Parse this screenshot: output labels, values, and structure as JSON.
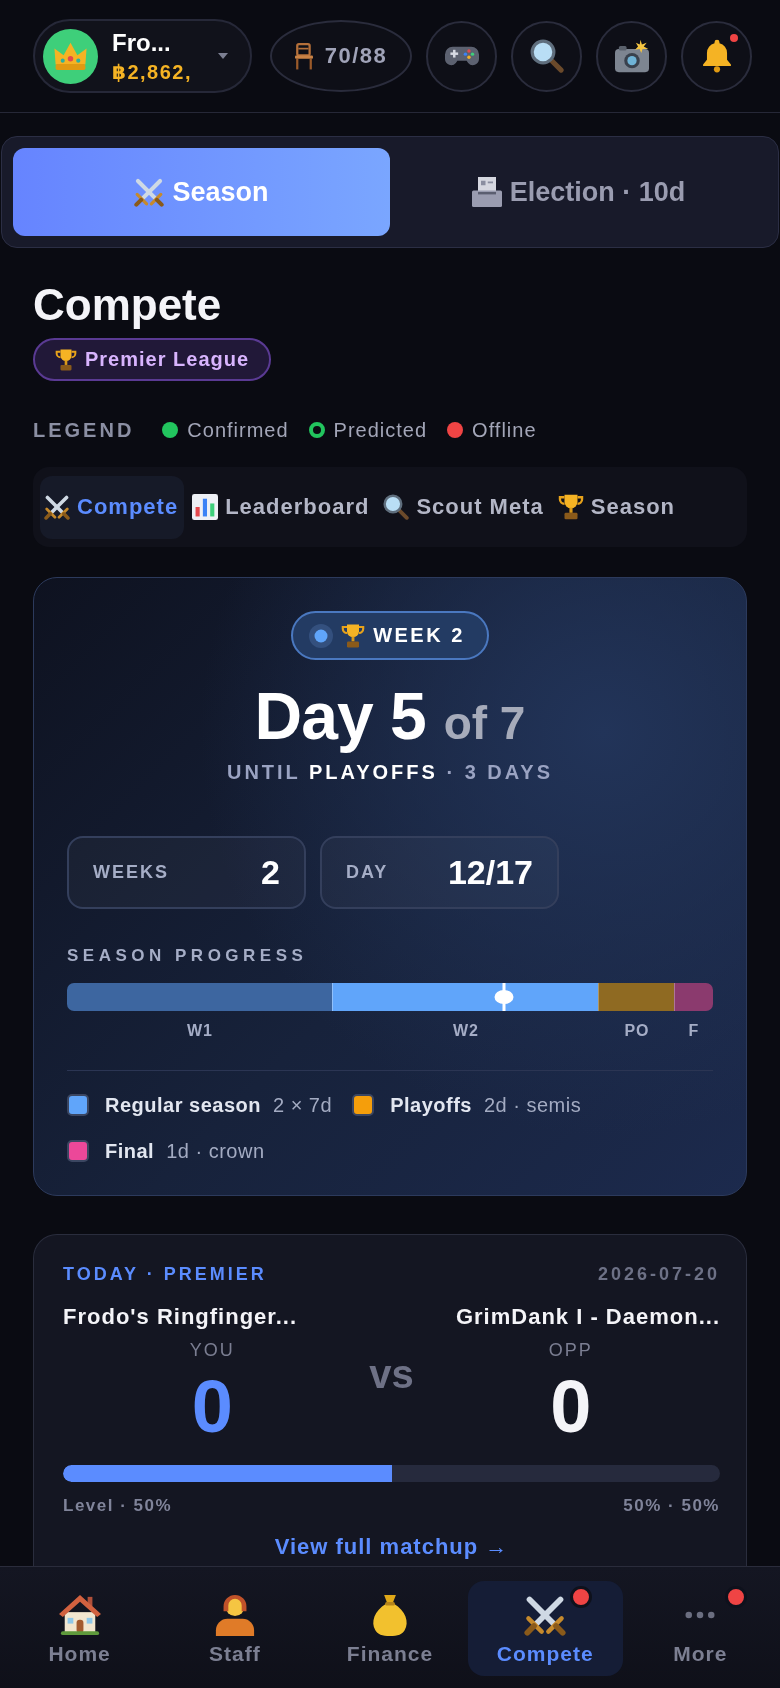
{
  "top_bar": {
    "profile": {
      "name": "Fro...",
      "balance": "฿2,862,"
    },
    "seats": "70/88",
    "actions": [
      {
        "badge": false
      },
      {
        "badge": false
      },
      {
        "badge": false
      },
      {
        "badge": true
      }
    ]
  },
  "mode_tabs": [
    {
      "label": "Season",
      "selected": true
    },
    {
      "label": "Election · 10d",
      "selected": false
    }
  ],
  "page": {
    "title": "Compete",
    "league": "Premier League"
  },
  "legend": {
    "title": "LEGEND",
    "items": [
      {
        "label": "Confirmed",
        "kind": "filled",
        "color": "#22c55e"
      },
      {
        "label": "Predicted",
        "kind": "ring",
        "color": "#22c55e"
      },
      {
        "label": "Offline",
        "kind": "filled",
        "color": "#ef4444"
      }
    ]
  },
  "section_tabs": [
    {
      "label": "Compete",
      "selected": true
    },
    {
      "label": "Leaderboard",
      "selected": false
    },
    {
      "label": "Scout Meta",
      "selected": false
    },
    {
      "label": "Season",
      "selected": false
    }
  ],
  "season_card": {
    "week": "WEEK 2",
    "day": "Day 5",
    "day_total": "of 7",
    "countdown": "UNTIL **PLAYOFFS** · 3 DAYS",
    "stats": [
      {
        "label": "WEEKS",
        "value": "2"
      },
      {
        "label": "DAY",
        "value": "12/17"
      }
    ],
    "progress": {
      "title": "SEASON PROGRESS",
      "segments": [
        {
          "label": "W1",
          "kind": "week",
          "color": "#3d66a0"
        },
        {
          "label": "W2",
          "kind": "week",
          "color": "#60a5fa"
        },
        {
          "label": "PO",
          "kind": "playoffs",
          "color": "#8f6a22"
        },
        {
          "label": "F",
          "kind": "final",
          "color": "#8b3a6e"
        }
      ],
      "marker": {
        "level": 0.677
      }
    },
    "phases": [
      {
        "name": "Regular season",
        "detail": "2 × 7d",
        "color": "#60a5fa"
      },
      {
        "name": "Playoffs",
        "detail": "2d · semis",
        "color": "#f59e0b"
      },
      {
        "name": "Final",
        "detail": "1d · crown",
        "color": "#ec4899"
      }
    ]
  },
  "matchup": {
    "header": "TODAY · PREMIER",
    "date": "2026-07-20",
    "teams": [
      {
        "name": "Frodo's Ringfinger...",
        "role": "YOU",
        "score": "0"
      },
      {
        "name": "GrimDank I - Daemon...",
        "role": "OPP",
        "score": "0"
      }
    ],
    "vs": "vs",
    "bar": {
      "level": 0.5
    },
    "captions": [
      "Level · 50%",
      "50% · 50%"
    ],
    "link": "View full matchup →"
  },
  "bottom_nav": [
    {
      "label": "Home",
      "selected": false,
      "badge": false
    },
    {
      "label": "Staff",
      "selected": false,
      "badge": false
    },
    {
      "label": "Finance",
      "selected": false,
      "badge": false
    },
    {
      "label": "Compete",
      "selected": true,
      "badge": true
    },
    {
      "label": "More",
      "selected": false,
      "badge": true
    }
  ]
}
